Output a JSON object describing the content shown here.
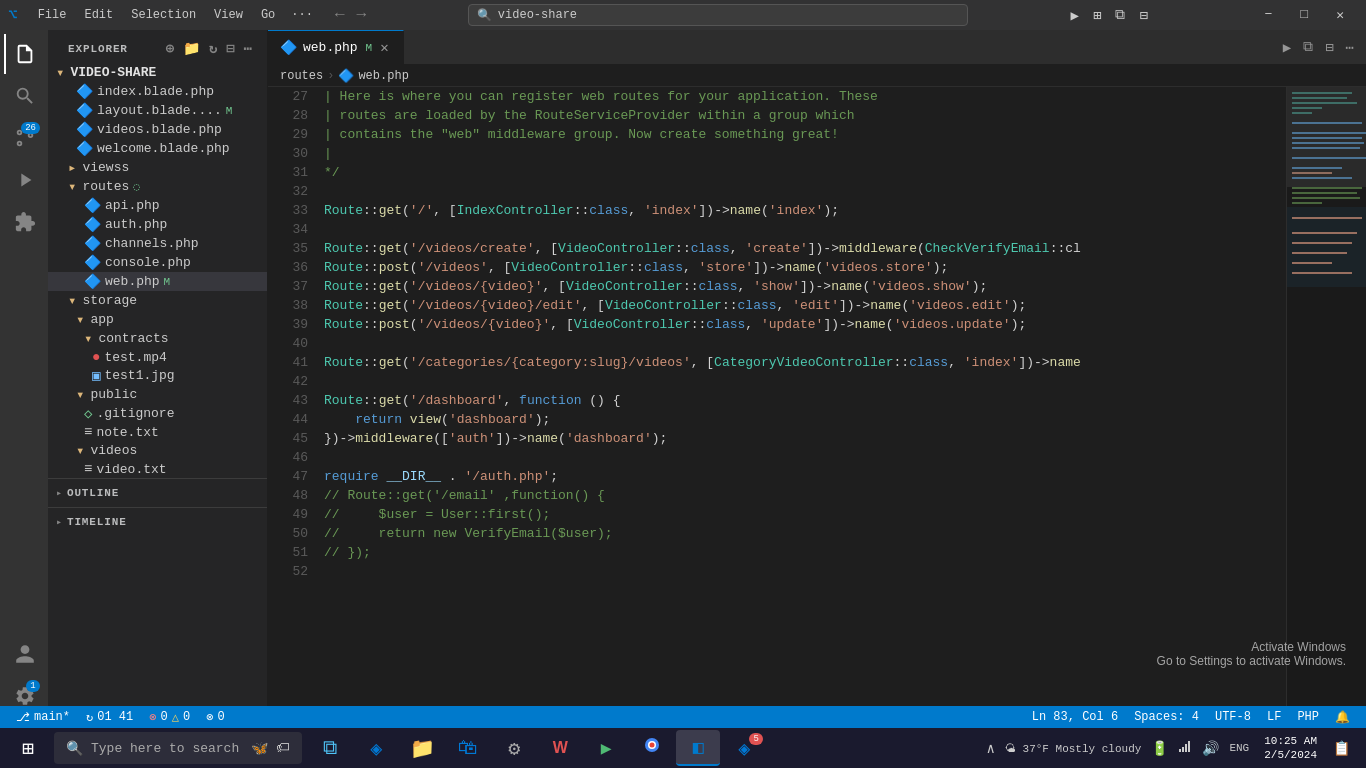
{
  "titlebar": {
    "logo": "VS",
    "menu": [
      "File",
      "Edit",
      "Selection",
      "View",
      "Go",
      "..."
    ],
    "search_placeholder": "video-share",
    "window_controls": [
      "⊟",
      "❐",
      "✕"
    ],
    "right_icons": [
      "▶",
      "⚙",
      "⧉",
      "⋮"
    ]
  },
  "activity_bar": {
    "items": [
      {
        "name": "explorer",
        "icon": "📄",
        "active": true
      },
      {
        "name": "search",
        "icon": "🔍",
        "active": false
      },
      {
        "name": "source-control",
        "icon": "⎇",
        "active": false,
        "badge": "26"
      },
      {
        "name": "run",
        "icon": "▶",
        "active": false
      },
      {
        "name": "extensions",
        "icon": "⧉",
        "active": false
      }
    ],
    "bottom_items": [
      {
        "name": "account",
        "icon": "👤"
      },
      {
        "name": "settings",
        "icon": "⚙",
        "badge": "1"
      }
    ]
  },
  "sidebar": {
    "title": "EXPLORER",
    "root": "VIDEO-SHARE",
    "tree": [
      {
        "indent": 1,
        "type": "php",
        "label": "index.blade.php",
        "modified": false
      },
      {
        "indent": 1,
        "type": "php",
        "label": "layout.blade....",
        "modified": true
      },
      {
        "indent": 1,
        "type": "php",
        "label": "videos.blade.php",
        "modified": false
      },
      {
        "indent": 1,
        "type": "php",
        "label": "welcome.blade.php",
        "modified": false
      },
      {
        "indent": 1,
        "type": "folder",
        "label": "viewss",
        "modified": false
      },
      {
        "indent": 1,
        "type": "folder-open",
        "label": "routes",
        "modified": true
      },
      {
        "indent": 2,
        "type": "php",
        "label": "api.php",
        "modified": false
      },
      {
        "indent": 2,
        "type": "php",
        "label": "auth.php",
        "modified": false
      },
      {
        "indent": 2,
        "type": "php",
        "label": "channels.php",
        "modified": false
      },
      {
        "indent": 2,
        "type": "php",
        "label": "console.php",
        "modified": false
      },
      {
        "indent": 2,
        "type": "php",
        "label": "web.php",
        "modified": true,
        "active": true
      },
      {
        "indent": 1,
        "type": "folder-open",
        "label": "storage",
        "modified": false
      },
      {
        "indent": 2,
        "type": "folder-open",
        "label": "app",
        "modified": false
      },
      {
        "indent": 3,
        "type": "folder-open",
        "label": "contracts",
        "modified": false
      },
      {
        "indent": 4,
        "type": "video",
        "label": "test.mp4",
        "modified": false
      },
      {
        "indent": 4,
        "type": "img",
        "label": "test1.jpg",
        "modified": false
      },
      {
        "indent": 2,
        "type": "folder-open",
        "label": "public",
        "modified": false
      },
      {
        "indent": 3,
        "type": "git",
        "label": ".gitignore",
        "modified": false
      },
      {
        "indent": 3,
        "type": "txt",
        "label": "note.txt",
        "modified": false
      },
      {
        "indent": 2,
        "type": "folder-open",
        "label": "videos",
        "modified": false
      },
      {
        "indent": 3,
        "type": "txt",
        "label": "video.txt",
        "modified": false
      }
    ],
    "outline_label": "OUTLINE",
    "timeline_label": "TIMELINE"
  },
  "tabs": [
    {
      "label": "web.php",
      "modified": true,
      "active": true,
      "icon": "php"
    }
  ],
  "breadcrumb": {
    "parts": [
      "routes",
      "web.php"
    ]
  },
  "code": {
    "lines": [
      {
        "num": 27,
        "content": "| Here is where you can register web routes for your application. These",
        "type": "comment"
      },
      {
        "num": 28,
        "content": "| routes are loaded by the RouteServiceProvider within a group which",
        "type": "comment"
      },
      {
        "num": 29,
        "content": "| contains the \"web\" middleware group. Now create something great!",
        "type": "comment"
      },
      {
        "num": 30,
        "content": "|",
        "type": "comment"
      },
      {
        "num": 31,
        "content": "*/",
        "type": "comment"
      },
      {
        "num": 32,
        "content": "",
        "type": "blank"
      },
      {
        "num": 33,
        "content": "Route::get('/', [IndexController::class, 'index'])->name('index');",
        "type": "code"
      },
      {
        "num": 34,
        "content": "",
        "type": "blank"
      },
      {
        "num": 35,
        "content": "Route::get('/videos/create', [VideoController::class, 'create'])->middleware(CheckVerifyEmail::cl",
        "type": "code"
      },
      {
        "num": 36,
        "content": "Route::post('/videos', [VideoController::class, 'store'])->name('videos.store');",
        "type": "code"
      },
      {
        "num": 37,
        "content": "Route::get('/videos/{video}', [VideoController::class, 'show'])->name('videos.show');",
        "type": "code"
      },
      {
        "num": 38,
        "content": "Route::get('/videos/{video}/edit', [VideoController::class, 'edit'])->name('videos.edit');",
        "type": "code"
      },
      {
        "num": 39,
        "content": "Route::post('/videos/{video}', [VideoController::class, 'update'])->name('videos.update');",
        "type": "code"
      },
      {
        "num": 40,
        "content": "",
        "type": "blank"
      },
      {
        "num": 41,
        "content": "Route::get('/categories/{category:slug}/videos', [CategoryVideoController::class, 'index'])->name",
        "type": "code"
      },
      {
        "num": 42,
        "content": "",
        "type": "blank"
      },
      {
        "num": 43,
        "content": "Route::get('/dashboard', function () {",
        "type": "code"
      },
      {
        "num": 44,
        "content": "    return view('dashboard');",
        "type": "code"
      },
      {
        "num": 45,
        "content": "})->middleware(['auth'])->name('dashboard');",
        "type": "code"
      },
      {
        "num": 46,
        "content": "",
        "type": "blank"
      },
      {
        "num": 47,
        "content": "require __DIR__ . '/auth.php';",
        "type": "code"
      },
      {
        "num": 48,
        "content": "// Route::get('/email' ,function() {",
        "type": "comment-code"
      },
      {
        "num": 49,
        "content": "//     $user = User::first();",
        "type": "comment-code"
      },
      {
        "num": 50,
        "content": "//     return new VerifyEmail($user);",
        "type": "comment-code"
      },
      {
        "num": 51,
        "content": "// });",
        "type": "comment-code"
      },
      {
        "num": 52,
        "content": "",
        "type": "blank"
      }
    ]
  },
  "status_bar": {
    "branch": "main*",
    "sync_icon": "↻",
    "sync_count": "01 41",
    "errors": "0",
    "warnings": "0",
    "no_problems": "△ 0",
    "remote": "⊗ 0",
    "ln_col": "Ln 83, Col 6",
    "spaces": "Spaces: 4",
    "encoding": "UTF-8",
    "line_ending": "LF",
    "lang": "PHP",
    "bell": "🔔"
  },
  "activate_windows": {
    "line1": "Activate Windows",
    "line2": "Go to Settings to activate Windows."
  },
  "taskbar": {
    "search_text": "Type here to search",
    "apps": [
      {
        "name": "windows",
        "icon": "⊞"
      },
      {
        "name": "task-view",
        "icon": "⧉"
      },
      {
        "name": "edge",
        "icon": "◈"
      },
      {
        "name": "explorer",
        "icon": "📁"
      },
      {
        "name": "store",
        "icon": "🏪"
      },
      {
        "name": "settings-app",
        "icon": "⚙"
      },
      {
        "name": "wamp",
        "icon": "W"
      },
      {
        "name": "terminal",
        "icon": "▶"
      },
      {
        "name": "chrome",
        "icon": "◉"
      },
      {
        "name": "vscode",
        "icon": "◧",
        "active": true
      },
      {
        "name": "edge2",
        "icon": "◈",
        "badge": "5"
      }
    ],
    "tray": {
      "weather": "🌤 37°F Mostly cloudy",
      "hidden_icons": "^",
      "battery": "🔋",
      "network": "🌐",
      "volume": "🔊",
      "lang": "ENG",
      "time": "10:25 AM",
      "date": "2/5/2024",
      "notification": "📋"
    }
  }
}
